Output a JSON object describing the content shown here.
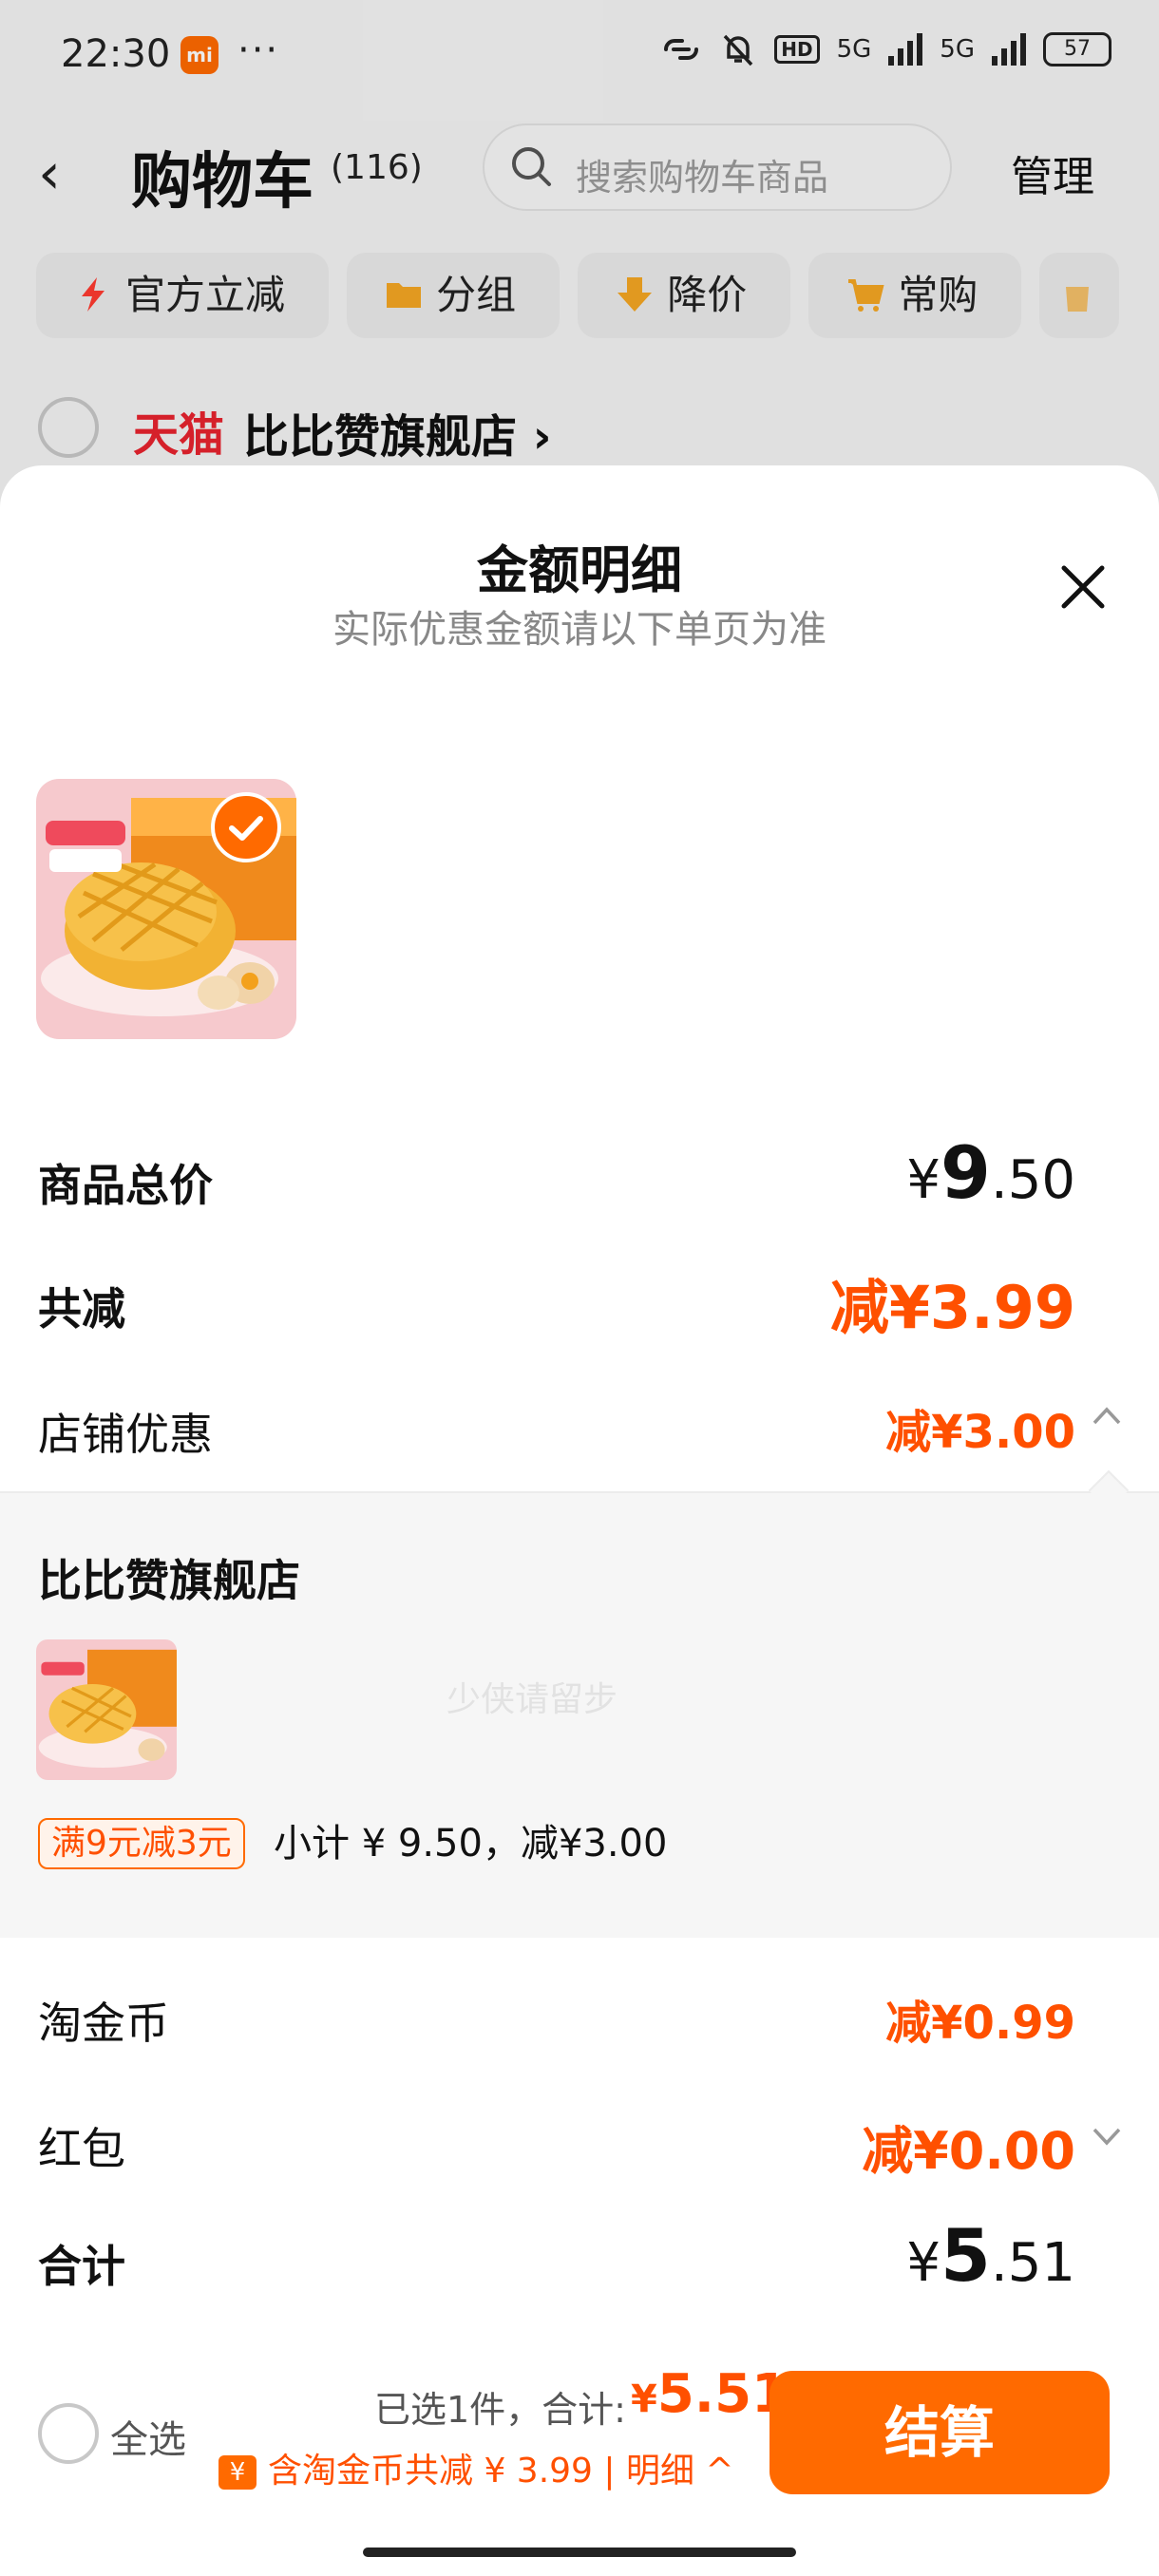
{
  "status_bar": {
    "time": "22:30",
    "mi_badge": "mi",
    "more_dots": "···",
    "hd": "HD",
    "net1": "5G",
    "net2": "5G",
    "battery": "57"
  },
  "header": {
    "back": "‹",
    "title": "购物车",
    "count": "(116)",
    "search_placeholder": "搜索购物车商品",
    "manage": "管理"
  },
  "chips": [
    {
      "label": "官方立减",
      "icon": "lightning-icon",
      "color": "#ff3b30"
    },
    {
      "label": "分组",
      "icon": "folder-icon",
      "color": "#f5a623"
    },
    {
      "label": "降价",
      "icon": "arrow-down-icon",
      "color": "#f5a623"
    },
    {
      "label": "常购",
      "icon": "cart-icon",
      "color": "#f5a623"
    }
  ],
  "store_row": {
    "mall": "天猫",
    "store": "比比赞旗舰店 ›"
  },
  "sheet": {
    "title": "金额明细",
    "subtitle": "实际优惠金额请以下单页为准",
    "rows": {
      "goods_total_label": "商品总价",
      "goods_total_symbol": "¥",
      "goods_total_int": "9",
      "goods_total_dec": ".50",
      "reduce_label": "共减",
      "reduce_value": "减¥3.99",
      "store_discount_label": "店铺优惠",
      "store_discount_value": "减¥3.00",
      "coin_label": "淘金币",
      "coin_value": "减¥0.99",
      "redpacket_label": "红包",
      "redpacket_value": "减¥0.00",
      "total_label": "合计",
      "total_symbol": "¥",
      "total_int": "5",
      "total_dec": ".51"
    },
    "shop": {
      "name": "比比赞旗舰店",
      "promo_tag": "满9元减3元",
      "promo_text": "小计 ¥ 9.50，减¥3.00"
    },
    "watermark": "少侠请留步"
  },
  "bottom_bar": {
    "select_all": "全选",
    "selected_text": "已选1件，合计:",
    "total_symbol": "¥",
    "total_value": "5.51",
    "coin_icon": "¥",
    "coin_line": "含淘金币共减 ¥ 3.99 | 明细 ^",
    "checkout": "结算"
  },
  "colors": {
    "accent": "#ff6a00",
    "price_orange": "#ff5000",
    "tmall_red": "#e8232e"
  }
}
